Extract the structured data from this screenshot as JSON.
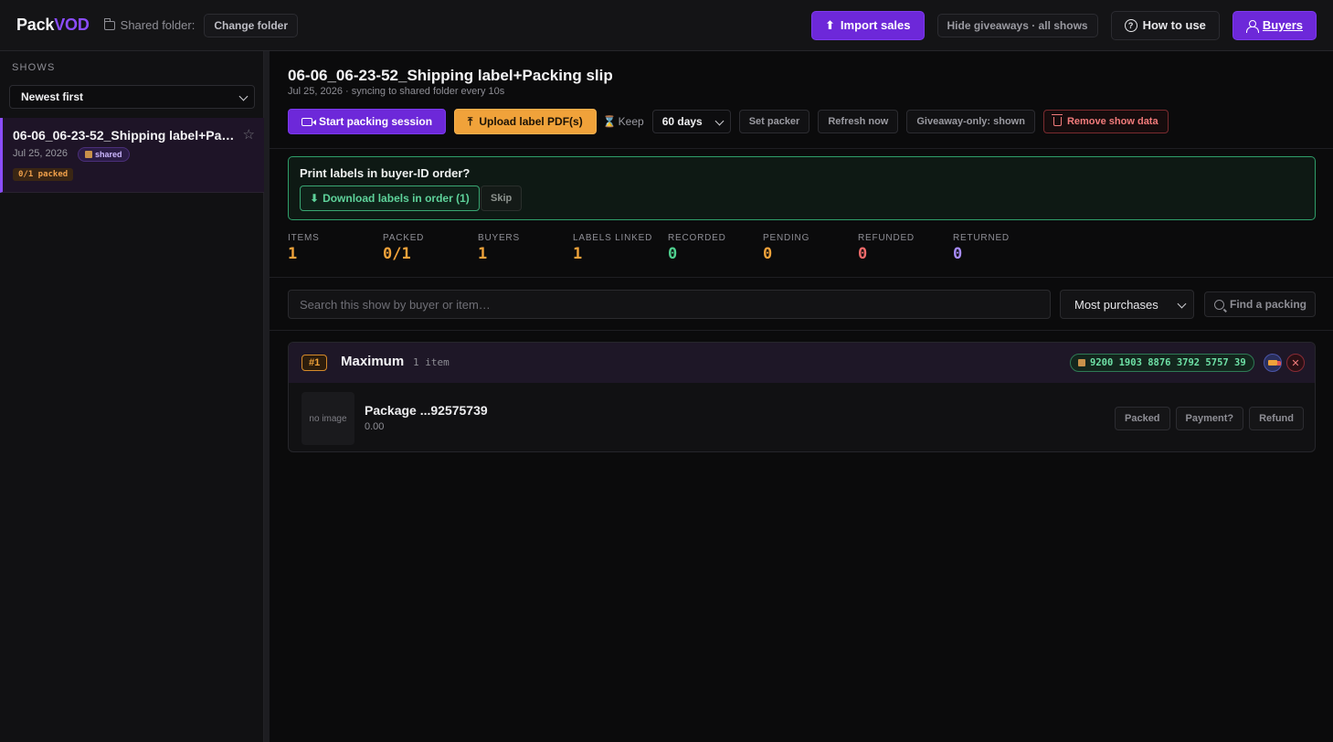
{
  "header": {
    "logo_left": "Pack",
    "logo_right": "VOD",
    "shared_folder_label": "Shared folder:",
    "change_folder": "Change folder",
    "import_sales": "Import sales",
    "hide_giveaways": "Hide giveaways · all shows",
    "how_to_use": "How to use",
    "buyers": "Buyers"
  },
  "sidebar": {
    "heading": "SHOWS",
    "sort": "Newest first",
    "shows": [
      {
        "title": "06-06_06-23-52_Shipping label+Packing slip",
        "date": "Jul 25, 2026",
        "badge": "shared",
        "packed": "0/1 packed"
      }
    ]
  },
  "main": {
    "title": "06-06_06-23-52_Shipping label+Packing slip",
    "subtitle": "Jul 25, 2026 · syncing to shared folder every 10s",
    "toolbar": {
      "start_session": "Start packing session",
      "upload_labels": "Upload label PDF(s)",
      "keep_label": "Keep",
      "keep_value": "60 days",
      "set_packer": "Set packer",
      "refresh": "Refresh now",
      "giveaway": "Giveaway-only: shown",
      "remove": "Remove show data"
    },
    "print_panel": {
      "question": "Print labels in buyer-ID order?",
      "download": "Download labels in order (1)",
      "skip": "Skip"
    },
    "stats": [
      {
        "label": "ITEMS",
        "value": "1",
        "color": "#f0a23a"
      },
      {
        "label": "PACKED",
        "value": "0/1",
        "color": "#f0a23a"
      },
      {
        "label": "BUYERS",
        "value": "1",
        "color": "#f0a23a"
      },
      {
        "label": "LABELS LINKED",
        "value": "1",
        "color": "#f0a23a"
      },
      {
        "label": "RECORDED",
        "value": "0",
        "color": "#4fd18f"
      },
      {
        "label": "PENDING",
        "value": "0",
        "color": "#f0a23a"
      },
      {
        "label": "REFUNDED",
        "value": "0",
        "color": "#f26b6b"
      },
      {
        "label": "RETURNED",
        "value": "0",
        "color": "#a78bfa"
      }
    ],
    "search": {
      "placeholder": "Search this show by buyer or item…",
      "sort": "Most purchases",
      "find": "Find a packing"
    },
    "buyers": [
      {
        "rank": "#1",
        "name": "Maximum",
        "count": "1 item",
        "tracking": "9200 1903 8876 3792 5757 39",
        "items": [
          {
            "image": "no image",
            "name": "Package ...92575739",
            "price": "0.00",
            "actions": [
              "Packed",
              "Payment?",
              "Refund"
            ]
          }
        ]
      }
    ]
  }
}
